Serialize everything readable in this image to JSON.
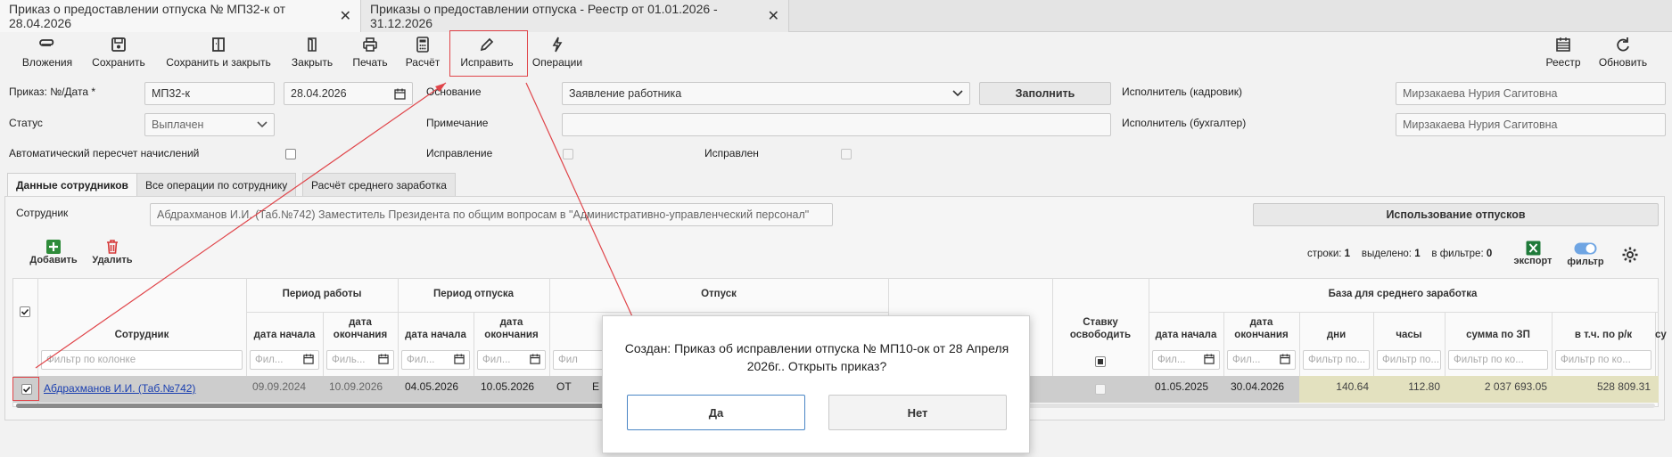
{
  "tabs": [
    {
      "label": "Приказ о предоставлении отпуска № МП32-к от 28.04.2026",
      "close": "✕"
    },
    {
      "label": "Приказы о предоставлении отпуска - Реестр от 01.01.2026 - 31.12.2026",
      "close": "✕"
    }
  ],
  "toolbar": {
    "attachments": "Вложения",
    "save": "Сохранить",
    "save_close": "Сохранить и закрыть",
    "close": "Закрыть",
    "print": "Печать",
    "calc": "Расчёт",
    "fix": "Исправить",
    "operations": "Операции",
    "registry": "Реестр",
    "refresh": "Обновить"
  },
  "form": {
    "order_label": "Приказ: №/Дата *",
    "order_number": "МП32-к",
    "order_date": "28.04.2026",
    "status_label": "Статус",
    "status_value": "Выплачен",
    "auto_recalc_label": "Автоматический пересчет начислений",
    "basis_label": "Основание",
    "basis_value": "Заявление работника",
    "fill_button": "Заполнить",
    "note_label": "Примечание",
    "note_value": "",
    "correction_label": "Исправление",
    "corrected_label": "Исправлен",
    "executor_hr_label": "Исполнитель (кадровик)",
    "executor_hr_value": "Мирзакаева Нурия Сагитовна",
    "executor_acc_label": "Исполнитель (бухгалтер)",
    "executor_acc_value": "Мирзакаева Нурия Сагитовна"
  },
  "subtabs": [
    "Данные сотрудников",
    "Все операции по сотруднику",
    "Расчёт среднего заработка"
  ],
  "employee": {
    "label": "Сотрудник",
    "value": "Абдрахманов И.И. (Таб.№742) Заместитель Президента по общим вопросам в \"Административно-управленческий персонал\"",
    "usage_button": "Использование отпусков"
  },
  "table_toolbar": {
    "add": "Добавить",
    "delete": "Удалить",
    "rows_label": "строки:",
    "rows_value": "1",
    "selected_label": "выделено:",
    "selected_value": "1",
    "filtered_label": "в фильтре:",
    "filtered_value": "0",
    "export": "экспорт",
    "filter": "фильтр"
  },
  "table": {
    "groups": {
      "work_period": "Период работы",
      "leave_period": "Период отпуска",
      "leave": "Отпуск",
      "avg_base": "База для среднего заработка"
    },
    "columns": {
      "employee": "Сотрудник",
      "start": "дата начала",
      "end": "дата окончания",
      "release_rate": "Ставку освободить",
      "days": "дни",
      "hours": "часы",
      "sum_salary": "сумма по ЗП",
      "incl_rk": "в т.ч. по р/к",
      "sum_cut": "су"
    },
    "filters": {
      "employee": "Фильтр по колонке",
      "date": "Фил...",
      "short": "Филь...",
      "date2": "Фил...",
      "leave": "Фил",
      "days": "Фильтр по...",
      "hours": "Фильтр по...",
      "sum": "Фильтр по ко...",
      "rk": "Фильтр по ко..."
    },
    "row": {
      "employee": "Абдрахманов И.И. (Таб.№742)",
      "work_start": "09.09.2024",
      "work_end": "10.09.2026",
      "leave_start": "04.05.2026",
      "leave_end": "10.05.2026",
      "leave_type": "ОТ",
      "leave_type2": "Е",
      "base_start": "01.05.2025",
      "base_end": "30.04.2026",
      "days": "140.64",
      "hours": "112.80",
      "sum_salary": "2 037 693.05",
      "incl_rk": "528 809.31"
    }
  },
  "dialog": {
    "message": "Создан: Приказ об исправлении отпуска № МП10-ок от 28 Апреля 2026г.. Открыть приказ?",
    "yes": "Да",
    "no": "Нет"
  },
  "colors": {
    "accent_red": "#e0454a",
    "selected_row": "#cdcdcd",
    "base_cells": "#e3e1bf",
    "link": "#1a3fb0"
  }
}
